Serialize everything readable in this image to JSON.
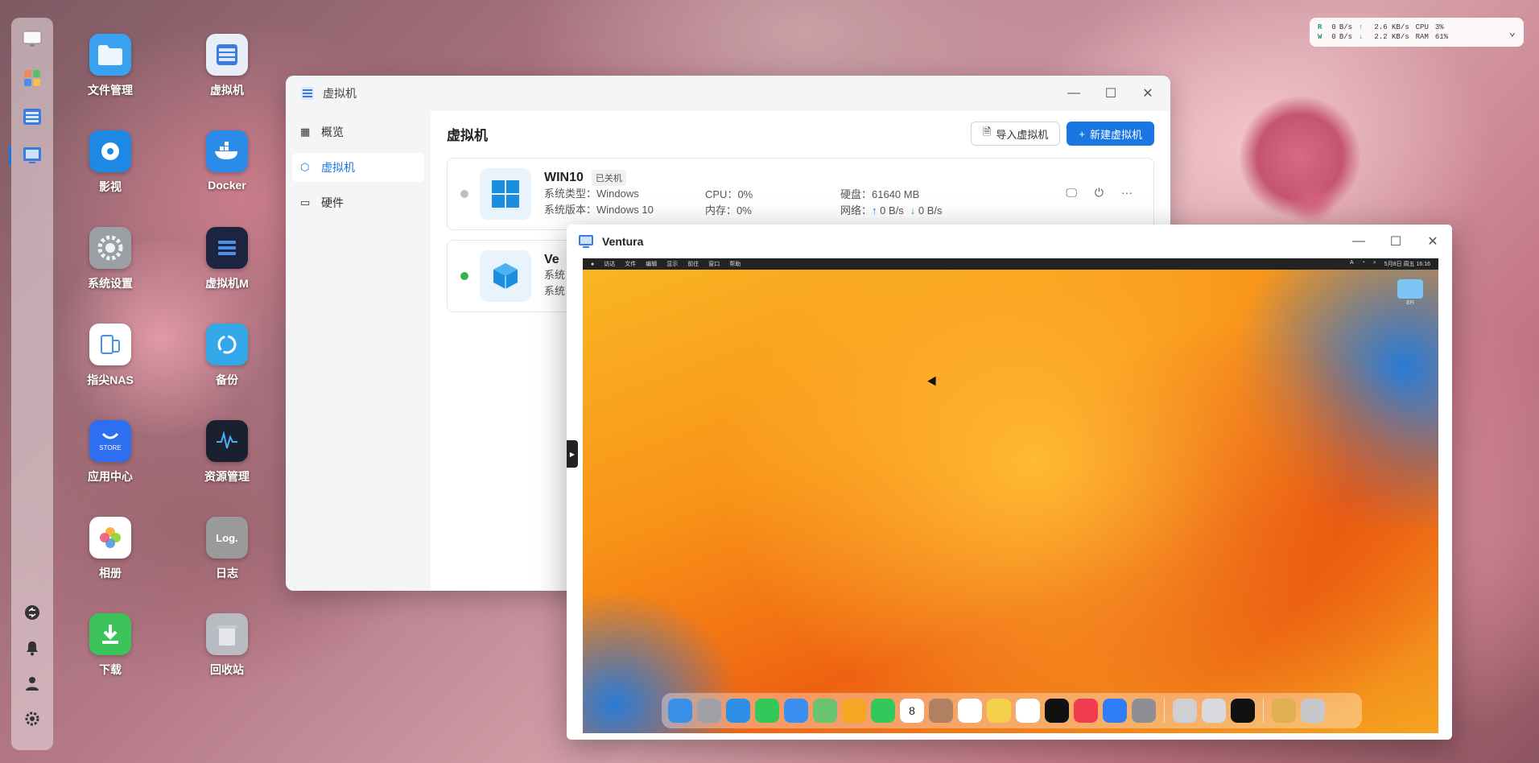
{
  "desktop_icons": [
    {
      "label": "文件管理",
      "icon": "folder-icon",
      "color": "#3aa0f0"
    },
    {
      "label": "虚拟机",
      "icon": "vm-icon",
      "color": "#e8eef8"
    },
    {
      "label": "影视",
      "icon": "film-icon",
      "color": "#1e88e5"
    },
    {
      "label": "Docker",
      "icon": "docker-icon",
      "color": "#2a8be8"
    },
    {
      "label": "系统设置",
      "icon": "gear-icon",
      "color": "#9aa0a6"
    },
    {
      "label": "虚拟机M",
      "icon": "vm-m-icon",
      "color": "#1c2440"
    },
    {
      "label": "指尖NAS",
      "icon": "nas-icon",
      "color": "#ffffff"
    },
    {
      "label": "备份",
      "icon": "backup-icon",
      "color": "#33a7e8"
    },
    {
      "label": "应用中心",
      "icon": "store-icon",
      "color": "#2d6ff0"
    },
    {
      "label": "资源管理",
      "icon": "monitor-icon",
      "color": "#1a2030"
    },
    {
      "label": "相册",
      "icon": "photos-icon",
      "color": "#ffffff"
    },
    {
      "label": "日志",
      "icon": "log-icon",
      "color": "#9a9a9a"
    },
    {
      "label": "下载",
      "icon": "download-icon",
      "color": "#3cc35a"
    },
    {
      "label": "回收站",
      "icon": "trash-icon",
      "color": "#b8bcc2"
    }
  ],
  "status": {
    "r_label": "R",
    "w_label": "W",
    "r_rate": "0",
    "w_rate": "0",
    "rate_unit": "B/s",
    "up_rate": "2.6 KB/s",
    "down_rate": "2.2 KB/s",
    "cpu_label": "CPU",
    "cpu_value": "3%",
    "ram_label": "RAM",
    "ram_value": "61%"
  },
  "vm_window": {
    "title": "虚拟机",
    "sidebar": [
      {
        "label": "概览",
        "active": false
      },
      {
        "label": "虚拟机",
        "active": true
      },
      {
        "label": "硬件",
        "active": false
      }
    ],
    "heading": "虚拟机",
    "import_button": "导入虚拟机",
    "new_button": "新建虚拟机",
    "vms": [
      {
        "name": "WIN10",
        "state": "已关机",
        "status_color": "#b7c0cc",
        "type_label": "系统类型：",
        "type_value": "Windows",
        "version_label": "系统版本：",
        "version_value": "Windows 10",
        "cpu_label": "CPU：",
        "cpu_value": "0%",
        "mem_label": "内存：",
        "mem_value": "0%",
        "disk_label": "硬盘：",
        "disk_value": "61640 MB",
        "net_label": "网络：",
        "net_up": "0 B/s",
        "net_down": "0 B/s"
      },
      {
        "name": "Ve",
        "status_color": "#3ab04a",
        "type_label": "系统",
        "version_label": "系统"
      }
    ]
  },
  "ventura_window": {
    "title": "Ventura",
    "menubar_items": [
      "访达",
      "文件",
      "编辑",
      "显示",
      "前往",
      "窗口",
      "帮助"
    ],
    "menubar_right": [
      "5月8日 周五 16:16"
    ],
    "desktop_icon_label": "EFI",
    "dock_colors": [
      "#3a90e8",
      "#a0a0a8",
      "#2e8ee8",
      "#34c759",
      "#3c8ef0",
      "#6ac36f",
      "#f5a623",
      "#34c759",
      "#ffffff",
      "#b08060",
      "#ffffff",
      "#f5d04a",
      "#ffffff",
      "#111111",
      "#f23c50",
      "#2e7cf6",
      "#8e8e93",
      "#cfcfd4",
      "#d9d9de",
      "#111111",
      "#e0b050",
      "#c8c8cc"
    ],
    "dock_calendar_day": "8"
  }
}
